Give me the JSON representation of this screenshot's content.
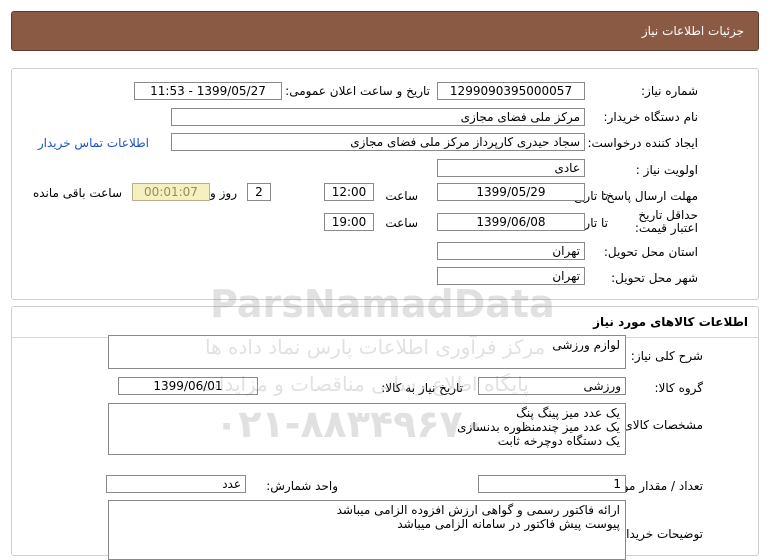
{
  "header": {
    "title": "جزئیات اطلاعات نیاز"
  },
  "need": {
    "number_label": "شماره نیاز:",
    "number": "1299090395000057",
    "announce_label": "تاریخ و ساعت اعلان عمومی:",
    "announce": "1399/05/27 - 11:53",
    "buyer_org_label": "نام دستگاه خریدار:",
    "buyer_org": "مرکز ملی فضای مجازی",
    "creator_label": "ایجاد کننده درخواست:",
    "creator": "سجاد حیدری کارپرداز مرکز ملی فضای مجازی",
    "contact_link": "اطلاعات تماس خریدار",
    "priority_label": "اولویت نیاز :",
    "priority": "عادی",
    "deadline_label": "مهلت ارسال پاسخ:",
    "to_date_label": "تا تاریخ :",
    "deadline_date": "1399/05/29",
    "time_label": "ساعت",
    "deadline_time": "12:00",
    "days": "2",
    "days_label": "روز و",
    "remaining": "00:01:07",
    "remaining_label": "ساعت باقی مانده",
    "validity_label": "حداقل تاریخ اعتبار قیمت:",
    "validity_to_label": "تا تاریخ :",
    "validity_date": "1399/06/08",
    "validity_time_label": "ساعت",
    "validity_time": "19:00",
    "province_label": "استان محل تحویل:",
    "province": "تهران",
    "city_label": "شهر محل تحویل:",
    "city": "تهران"
  },
  "goods": {
    "section_title": "اطلاعات کالاهای مورد نیاز",
    "summary_label": "شرح کلی نیاز:",
    "summary": "لوازم ورزشی",
    "group_label": "گروه کالا:",
    "group": "ورزشی",
    "need_date_label": "تاریخ نیاز به کالا:",
    "need_date": "1399/06/01",
    "specs_label": "مشخصات کالای مورد نیاز:",
    "specs": [
      "یک عدد میز پینگ پنگ",
      "یک عدد میز چندمنظوره بدنسازی",
      "یک دستگاه دوچرخه ثابت"
    ],
    "qty_label": "تعداد / مقدار مورد نیاز:",
    "qty": "1",
    "unit_label": "واحد شمارش:",
    "unit": "عدد",
    "buyer_notes_label": "توضیحات خریدار:",
    "buyer_notes": [
      "ارائه فاکتور رسمی و گواهی ارزش افزوده الزامی میباشد",
      "پیوست پیش فاکتور در سامانه الزامی میباشد"
    ]
  },
  "watermark": {
    "brand": "ParsNamadData",
    "line1": "مرکز فرآوری اطلاعات پارس نماد داده ها",
    "line2": "پایگاه اطلاع رسانی مناقصات و مزایدات",
    "phone": "۰۲۱-۸۸۳۴۹۶۷۰"
  },
  "colors": {
    "header_bg": "#8b5a45",
    "link": "#1a53c4",
    "timer_bg": "#f4f0bf"
  }
}
